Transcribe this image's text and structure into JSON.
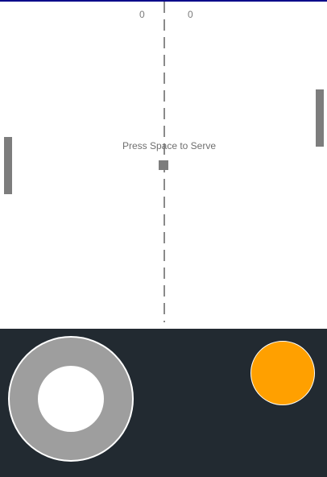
{
  "game": {
    "scores": {
      "left": "0",
      "right": "0"
    },
    "message": "Press Space to Serve"
  },
  "colors": {
    "top_accent": "#0a0a8a",
    "field_background": "#ffffff",
    "paddle": "#7d7d7d",
    "ball": "#7d7d7d",
    "center_line": "#8a8a8a",
    "controls_background": "#222a31",
    "joystick_base": "#9e9e9e",
    "joystick_knob": "#ffffff",
    "action_button": "#ffa000"
  },
  "controls": {
    "joystick": "virtual-joystick",
    "action_button": "action-button"
  }
}
